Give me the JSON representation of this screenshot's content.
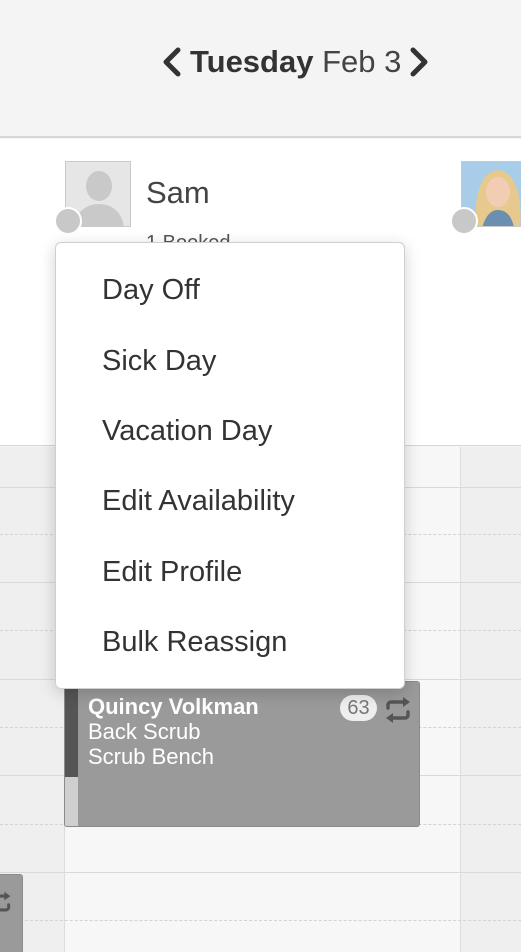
{
  "date_nav": {
    "day_of_week": "Tuesday",
    "month_day": "Feb 3",
    "prev_icon": "chevron-left-icon",
    "next_icon": "chevron-right-icon"
  },
  "staff": [
    {
      "name": "Sam",
      "subtitle": "1 Booked",
      "avatar": "user-silhouette-icon"
    },
    {
      "avatar": "staff-photo"
    }
  ],
  "context_menu": {
    "items": [
      {
        "label": "Day Off"
      },
      {
        "label": "Sick Day"
      },
      {
        "label": "Vacation Day"
      },
      {
        "label": "Edit Availability"
      },
      {
        "label": "Edit Profile"
      },
      {
        "label": "Bulk Reassign"
      }
    ]
  },
  "appointment": {
    "client": "Quincy Volkman",
    "service": "Back Scrub",
    "resource": "Scrub Bench",
    "badge": "63",
    "repeat_icon": "repeat-icon"
  },
  "colors": {
    "appointment_fill": "#9a9a9a",
    "appointment_stripe": "#555555",
    "menu_background": "#ffffff",
    "header_background": "#f4f4f4"
  }
}
